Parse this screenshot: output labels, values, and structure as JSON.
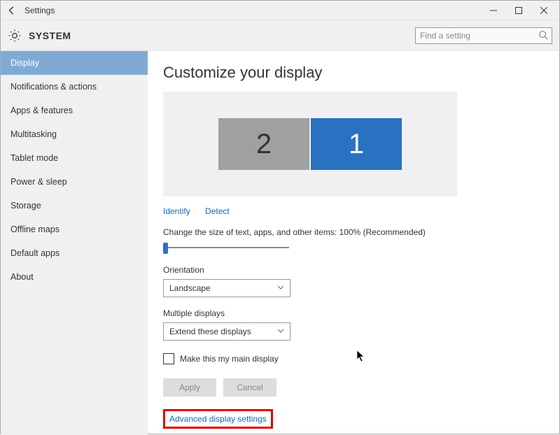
{
  "window": {
    "title": "Settings"
  },
  "header": {
    "section": "SYSTEM",
    "search_placeholder": "Find a setting"
  },
  "sidebar": {
    "items": [
      {
        "label": "Display",
        "active": true
      },
      {
        "label": "Notifications & actions"
      },
      {
        "label": "Apps & features"
      },
      {
        "label": "Multitasking"
      },
      {
        "label": "Tablet mode"
      },
      {
        "label": "Power & sleep"
      },
      {
        "label": "Storage"
      },
      {
        "label": "Offline maps"
      },
      {
        "label": "Default apps"
      },
      {
        "label": "About"
      }
    ]
  },
  "main": {
    "title": "Customize your display",
    "monitors": {
      "secondary_label": "2",
      "primary_label": "1"
    },
    "links": {
      "identify": "Identify",
      "detect": "Detect"
    },
    "scale_label": "Change the size of text, apps, and other items: 100% (Recommended)",
    "orientation_label": "Orientation",
    "orientation_value": "Landscape",
    "multiple_label": "Multiple displays",
    "multiple_value": "Extend these displays",
    "main_display_checkbox": "Make this my main display",
    "buttons": {
      "apply": "Apply",
      "cancel": "Cancel"
    },
    "advanced_link": "Advanced display settings"
  }
}
